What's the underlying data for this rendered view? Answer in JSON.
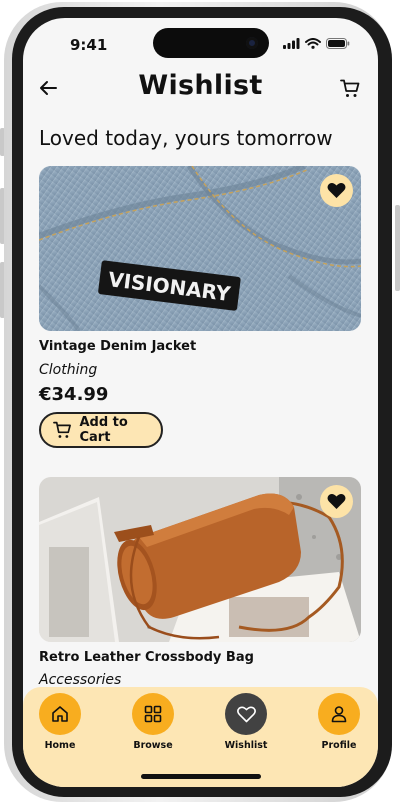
{
  "status": {
    "time": "9:41"
  },
  "header": {
    "title": "Wishlist",
    "back_icon": "arrow-left-icon",
    "cart_icon": "cart-icon"
  },
  "heading": "Loved today, yours tomorrow",
  "products": [
    {
      "name": "Vintage Denim Jacket",
      "category": "Clothing",
      "price": "€34.99",
      "button_label": "Add to Cart",
      "patch_text": "VISIONARY"
    },
    {
      "name": "Retro Leather Crossbody Bag",
      "category": "Accessories"
    }
  ],
  "nav": {
    "items": [
      {
        "label": "Home",
        "icon": "home-icon"
      },
      {
        "label": "Browse",
        "icon": "grid-icon"
      },
      {
        "label": "Wishlist",
        "icon": "heart-icon",
        "active": true
      },
      {
        "label": "Profile",
        "icon": "user-icon"
      }
    ]
  },
  "colors": {
    "accent": "#f8ad1f",
    "accent_light": "#fde6b4",
    "active_nav": "#424242"
  }
}
